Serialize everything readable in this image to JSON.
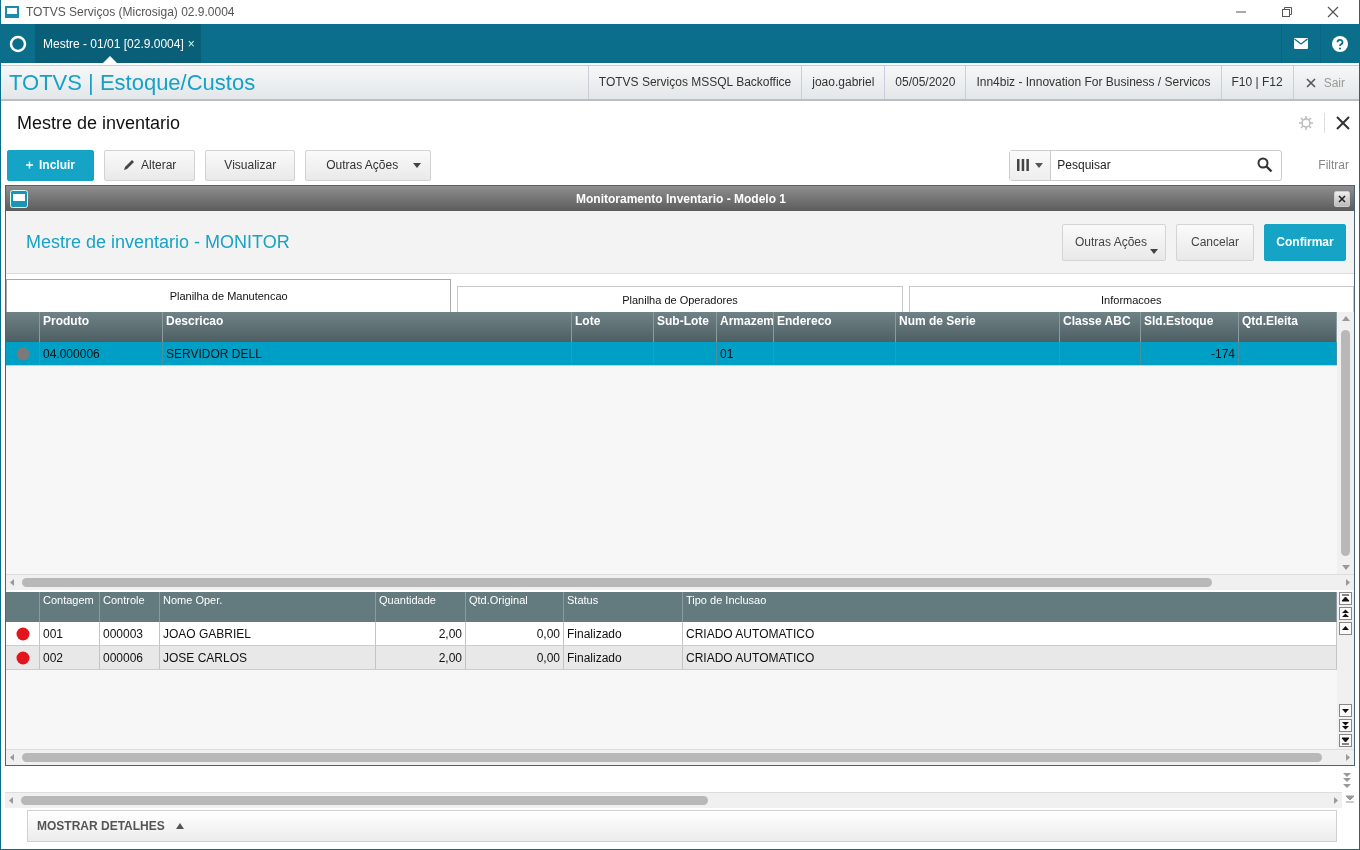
{
  "window": {
    "title": "TOTVS Serviços (Microsiga) 02.9.0004"
  },
  "app_tabs": [
    {
      "label": "Mestre - 01/01 [02.9.0004]",
      "close": "×",
      "selected": true
    }
  ],
  "header": {
    "brand": "TOTVS | Estoque/Custos",
    "info": [
      "TOTVS Serviços MSSQL Backoffice",
      "joao.gabriel",
      "05/05/2020",
      "Inn4biz - Innovation For Business / Servicos",
      "F10 | F12"
    ],
    "exit": "Sair"
  },
  "page": {
    "title": "Mestre de inventario",
    "actions": [
      {
        "label": "Incluir",
        "kind": "primary"
      },
      {
        "label": "Alterar",
        "kind": "edit"
      },
      {
        "label": "Visualizar",
        "kind": "plain"
      },
      {
        "label": "Outras Ações",
        "kind": "menu"
      }
    ],
    "search": {
      "placeholder": "Pesquisar"
    },
    "filter": "Filtrar"
  },
  "dialog": {
    "title": "Monitoramento Inventario - Modelo 1",
    "heading": "Mestre de inventario - MONITOR",
    "buttons": [
      {
        "label": "Outras Ações",
        "kind": "menu"
      },
      {
        "label": "Cancelar",
        "kind": "plain"
      },
      {
        "label": "Confirmar",
        "kind": "primary"
      }
    ],
    "tabs": [
      {
        "label": "Planilha de Manutencao",
        "selected": true
      },
      {
        "label": "Planilha de Operadores",
        "selected": false
      },
      {
        "label": "Informacoes",
        "selected": false
      }
    ],
    "grids": [
      {
        "columns": [
          "Produto",
          "Descricao",
          "Lote",
          "Sub-Lote",
          "Armazem",
          "Endereco",
          "Num de Serie",
          "Classe ABC",
          "Sld.Estoque",
          "Qtd.Eleita"
        ],
        "rows": [
          {
            "color": "#7a7a7a",
            "selected": true,
            "cells": [
              "04.000006",
              "SERVIDOR DELL",
              null,
              null,
              "01",
              null,
              null,
              null,
              "-174",
              null
            ]
          }
        ]
      },
      {
        "columns": [
          "Contagem",
          "Controle",
          "Nome Oper.",
          "Quantidade",
          "Qtd.Original",
          "Status",
          "Tipo de Inclusao"
        ],
        "rows": [
          {
            "color": "#e3141b",
            "selected": false,
            "cells": [
              "001",
              "000003",
              "JOAO GABRIEL",
              "2,00",
              "0,00",
              "Finalizado",
              "CRIADO AUTOMATICO"
            ]
          },
          {
            "color": "#e3141b",
            "selected": false,
            "cells": [
              "002",
              "000006",
              "JOSE CARLOS",
              "2,00",
              "0,00",
              "Finalizado",
              "CRIADO AUTOMATICO"
            ]
          }
        ]
      }
    ]
  },
  "footer": {
    "toggle": "MOSTRAR DETALHES"
  }
}
